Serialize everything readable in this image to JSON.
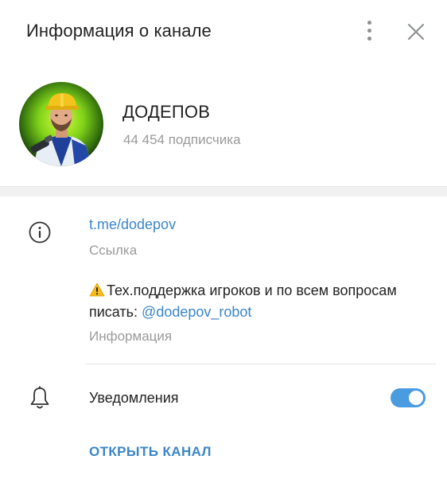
{
  "header": {
    "title": "Информация о канале",
    "menu_icon": "more-vertical-icon",
    "close_icon": "close-icon"
  },
  "profile": {
    "name": "ДОДЕПОВ",
    "subscribers": "44 454 подписчика"
  },
  "info": {
    "icon": "info-icon",
    "link": "t.me/dodepov",
    "link_label": "Ссылка",
    "description_text": "Тех.поддержка игроков и по всем вопросам писать: ",
    "description_mention": "@dodepov_robot",
    "description_label": "Информация"
  },
  "notifications": {
    "icon": "bell-icon",
    "label": "Уведомления",
    "enabled": true
  },
  "actions": {
    "open_channel": "ОТКРЫТЬ КАНАЛ"
  },
  "colors": {
    "accent": "#3a86c8",
    "toggle": "#4a9be0",
    "muted": "#9a9a9a"
  }
}
